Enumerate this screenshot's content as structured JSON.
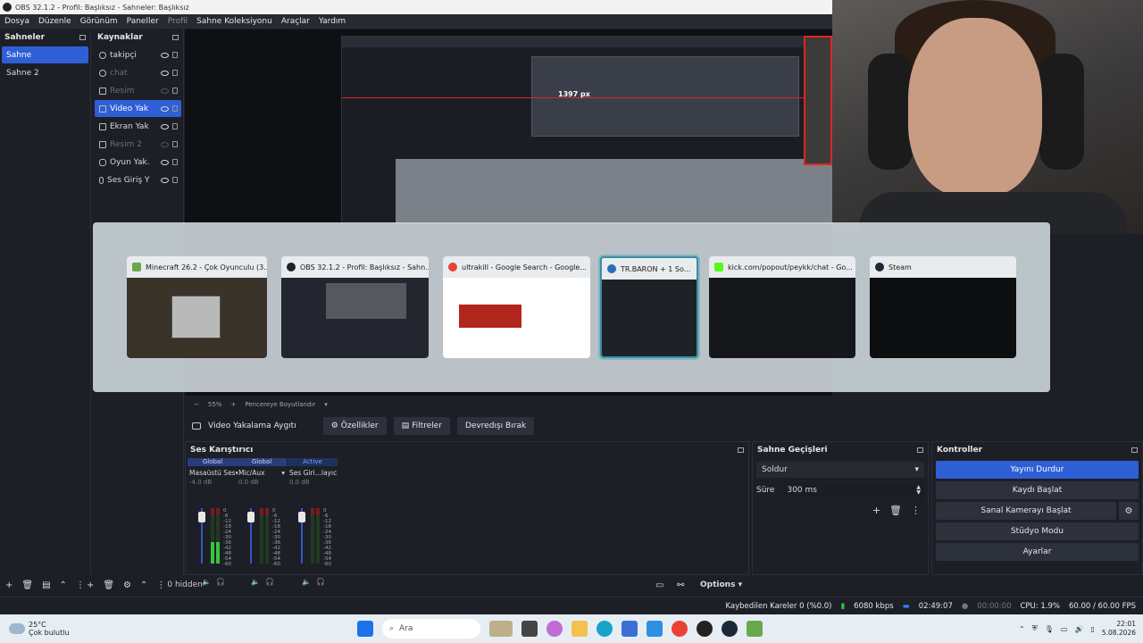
{
  "window": {
    "title": "OBS 32.1.2 - Profil: Başlıksız - Sahneler: Başlıksız"
  },
  "menu": [
    {
      "label": "Dosya",
      "enabled": true
    },
    {
      "label": "Düzenle",
      "enabled": true
    },
    {
      "label": "Görünüm",
      "enabled": true
    },
    {
      "label": "Paneller",
      "enabled": true
    },
    {
      "label": "Profil",
      "enabled": false
    },
    {
      "label": "Sahne Koleksiyonu",
      "enabled": true
    },
    {
      "label": "Araçlar",
      "enabled": true
    },
    {
      "label": "Yardım",
      "enabled": true
    }
  ],
  "scenes": {
    "title": "Sahneler",
    "items": [
      "Sahne",
      "Sahne 2"
    ],
    "selected": 0
  },
  "sources": {
    "title": "Kaynaklar",
    "items": [
      {
        "label": "takipçi",
        "visible": true
      },
      {
        "label": "chat",
        "visible": true
      },
      {
        "label": "Resim",
        "visible": false
      },
      {
        "label": "Video Yak",
        "visible": true
      },
      {
        "label": "Ekran Yak",
        "visible": true
      },
      {
        "label": "Resim 2",
        "visible": false
      },
      {
        "label": "Oyun Yak.",
        "visible": true
      },
      {
        "label": "Ses Giriş Y",
        "visible": true
      }
    ],
    "selected": 3
  },
  "preview": {
    "measure_label": "1397 px",
    "zoom": "55%",
    "zoom_mode": "Pencereye Boyutlandır"
  },
  "switcher": {
    "windows": [
      {
        "title": "Minecraft 26.2 - Çok Oyunculu (3...",
        "icon_color": "#6aa84f"
      },
      {
        "title": "OBS 32.1.2 - Profil: Başlıksız - Sahn...",
        "icon_color": "#222222"
      },
      {
        "title": "ultrakill - Google Search - Google...",
        "icon_color": "#ea4335"
      },
      {
        "title": "TR.BARON + 1 So...",
        "icon_color": "#2a6eb5"
      },
      {
        "title": "kick.com/popout/peykk/chat - Go...",
        "icon_color": "#53fc18"
      },
      {
        "title": "Steam",
        "icon_color": "#1b2838"
      }
    ],
    "focused": 3
  },
  "context": {
    "source_name": "Video Yakalama Aygıtı",
    "properties": "Özellikler",
    "filters": "Filtreler",
    "deactivate": "Devredışı Bırak"
  },
  "mixer": {
    "title": "Ses Karıştırıcı",
    "channels": [
      {
        "badge": "Global",
        "name": "Masaüstü Ses",
        "db": "-4.0 dB",
        "level": 0.38,
        "active": false
      },
      {
        "badge": "Global",
        "name": "Mic/Aux",
        "db": "0.0 dB",
        "level": 0.0,
        "active": false
      },
      {
        "badge": "Active",
        "name": "Ses Giri...layıcısı",
        "db": "0.0 dB",
        "level": 0.0,
        "active": true
      }
    ],
    "scale": [
      "0",
      "-6",
      "-12",
      "-18",
      "-24",
      "-30",
      "-36",
      "-42",
      "-48",
      "-54",
      "-60"
    ],
    "hidden_count": "0 hidden",
    "options": "Options"
  },
  "transitions": {
    "title": "Sahne Geçişleri",
    "selected": "Soldur",
    "duration_label": "Süre",
    "duration": "300 ms"
  },
  "controls": {
    "title": "Kontroller",
    "stop_stream": "Yayını Durdur",
    "start_record": "Kaydı Başlat",
    "virtual_cam": "Sanal Kamerayı Başlat",
    "studio_mode": "Stüdyo Modu",
    "settings": "Ayarlar"
  },
  "status": {
    "dropped": "Kaybedilen Kareler 0 (%0.0)",
    "bitrate": "6080 kbps",
    "stream_time": "02:49:07",
    "record_time": "00:00:00",
    "cpu": "CPU: 1.9%",
    "fps": "60.00 / 60.00 FPS"
  },
  "taskbar": {
    "temp": "25°C",
    "weather": "Çok bulutlu",
    "search": "Ara",
    "time": "22:01",
    "date": "5.08.2026"
  }
}
